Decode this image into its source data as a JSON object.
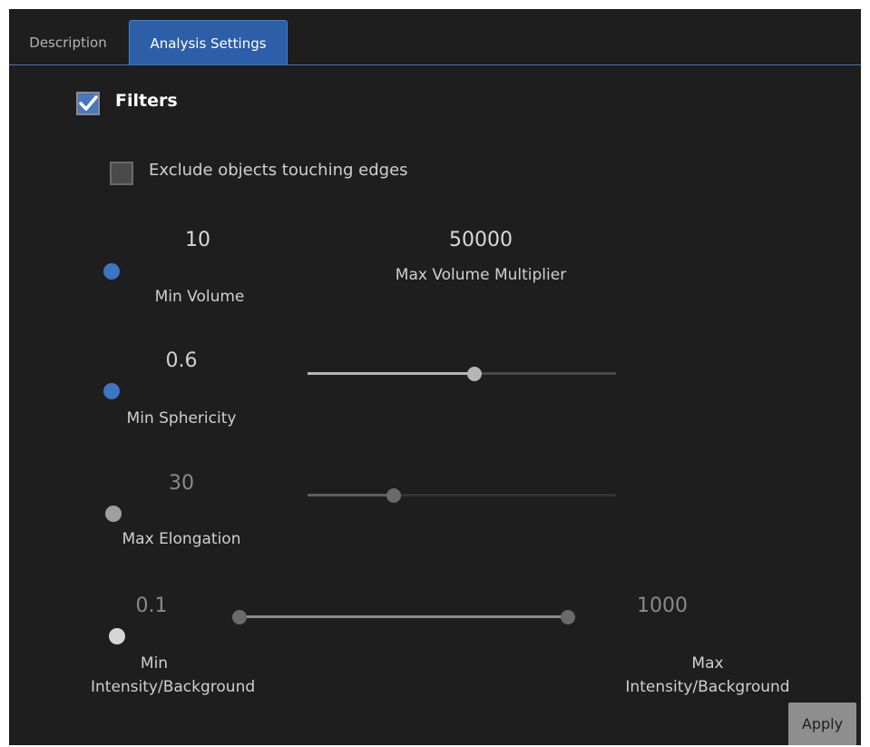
{
  "tabs": [
    {
      "label": "Description",
      "active": false
    },
    {
      "label": "Analysis Settings",
      "active": true
    }
  ],
  "filters": {
    "label": "Filters",
    "checked": true,
    "exclude_edges": {
      "label": "Exclude objects touching edges",
      "checked": false
    },
    "min_volume": {
      "value": "10",
      "label": "Min Volume"
    },
    "max_volume_multiplier": {
      "value": "50000",
      "label": "Max Volume Multiplier"
    },
    "min_sphericity": {
      "value": "0.6",
      "label": "Min Sphericity",
      "slider_fraction": 0.54
    },
    "max_elongation": {
      "value": "30",
      "label": "Max Elongation",
      "slider_fraction": 0.28
    },
    "min_intensity": {
      "value": "0.1",
      "label_line1": "Min",
      "label_line2": "Intensity/Background"
    },
    "max_intensity": {
      "value": "1000",
      "label_line1": "Max",
      "label_line2": "Intensity/Background"
    }
  },
  "apply_label": "Apply",
  "colors": {
    "background": "#1e1e1e",
    "accent": "#3d74c4",
    "active_tab": "#2d5ea8"
  }
}
